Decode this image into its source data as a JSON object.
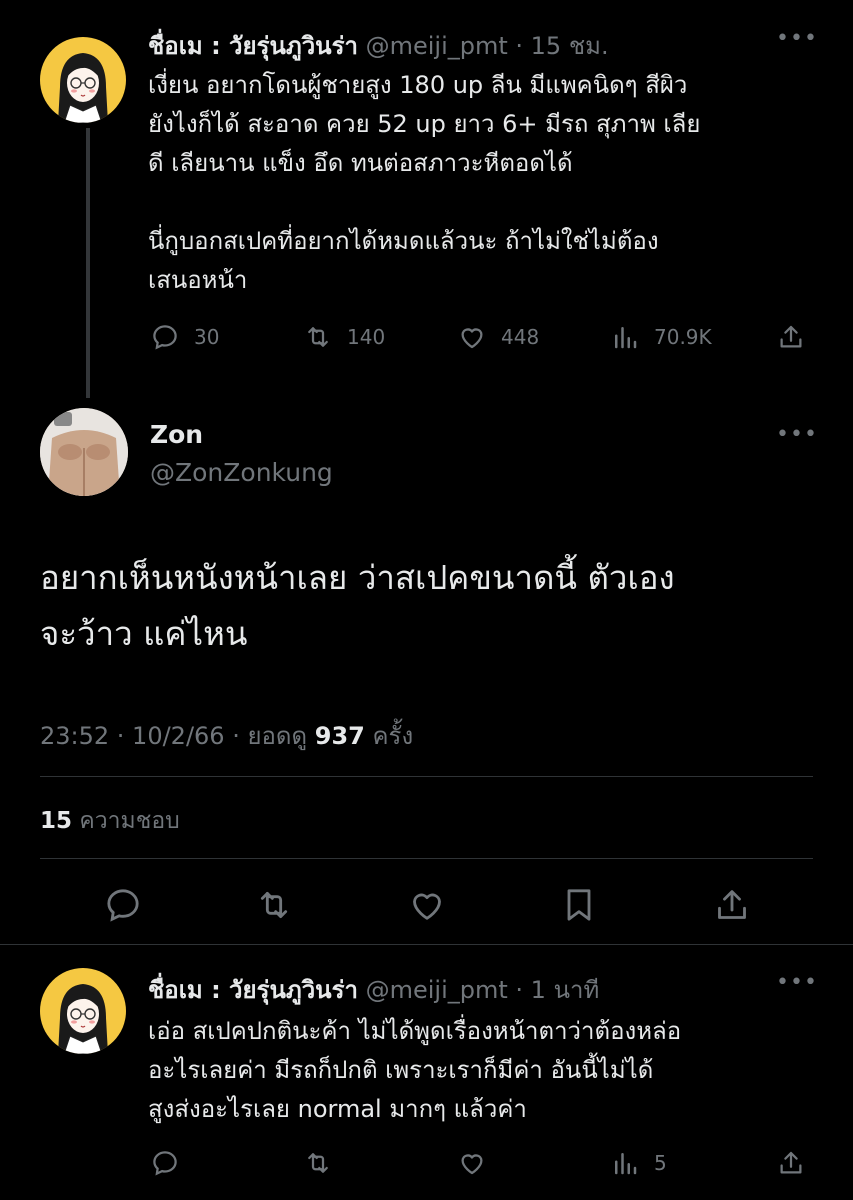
{
  "tweet1": {
    "display_name": "ชื่อเม : วัยรุ่นภูวินร่า",
    "handle": "@meiji_pmt",
    "time": "· 15 ชม.",
    "text": "เงี่ยน อยากโดนผู้ชายสูง 180 up ลีน มีแพคนิดๆ สีผิว\nยังไงก็ได้ สะอาด ควย 52 up ยาว 6+ มีรถ สุภาพ เลีย\nดี เลียนาน แข็ง อึด ทนต่อสภาวะหีตอดได้\n\nนี่กูบอกสเปคที่อยากได้หมดแล้วนะ ถ้าไม่ใช่ไม่ต้อง\nเสนอหน้า",
    "replies": "30",
    "retweets": "140",
    "likes": "448",
    "views": "70.9K",
    "more": "•••"
  },
  "main": {
    "display_name": "Zon",
    "handle": "@ZonZonkung",
    "text": "อยากเห็นหนังหน้าเลย ว่าสเปคขนาดนี้ ตัวเอง\nจะว้าว แค่ไหน",
    "timestamp": "23:52 · 10/2/66 · ยอดดู",
    "views": "937",
    "views_unit": "ครั้ง",
    "likes_count": "15",
    "likes_label": "ความชอบ",
    "more": "•••"
  },
  "tweet3": {
    "display_name": "ชื่อเม : วัยรุ่นภูวินร่า",
    "handle": "@meiji_pmt",
    "time": "· 1 นาที",
    "text": "เอ่อ สเปคปกตินะค้า ไม่ได้พูดเรื่องหน้าตาว่าต้องหล่อ\nอะไรเลยค่า มีรถก็ปกติ เพราะเราก็มีค่า อันนี้ไม่ได้\nสูงส่งอะไรเลย normal มากๆ แล้วค่า",
    "views": "5",
    "more": "•••"
  },
  "colors": {
    "background": "#000000",
    "text": "#e7e9ea",
    "muted": "#71767b",
    "avatar_bg": "#f5c842"
  }
}
